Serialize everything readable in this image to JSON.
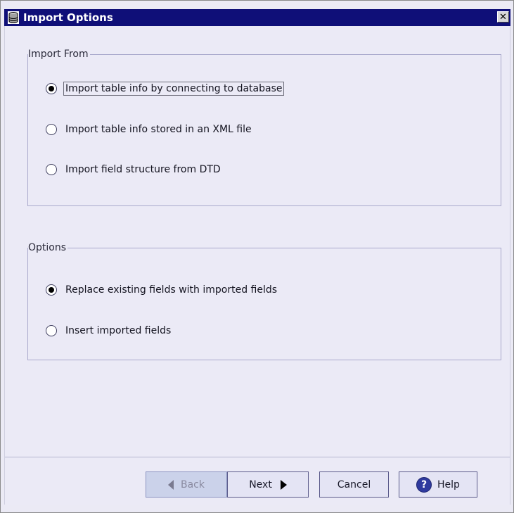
{
  "window": {
    "title": "Import Options",
    "close_glyph": "✕",
    "icon": "database-icon"
  },
  "import_from": {
    "label": "Import From",
    "options": [
      {
        "label": "Import table info by connecting to database",
        "checked": true
      },
      {
        "label": "Import table info stored in an XML file",
        "checked": false
      },
      {
        "label": "Import field structure from DTD",
        "checked": false
      }
    ]
  },
  "options": {
    "label": "Options",
    "options": [
      {
        "label": "Replace existing fields with imported fields",
        "checked": true
      },
      {
        "label": "Insert imported fields",
        "checked": false
      }
    ]
  },
  "buttons": {
    "back": "Back",
    "next": "Next",
    "cancel": "Cancel",
    "help": "Help",
    "help_glyph": "?"
  },
  "colors": {
    "titlebar": "#0f0f78",
    "dialog_bg": "#ebeaf6",
    "group_border": "#a9a9cc"
  }
}
